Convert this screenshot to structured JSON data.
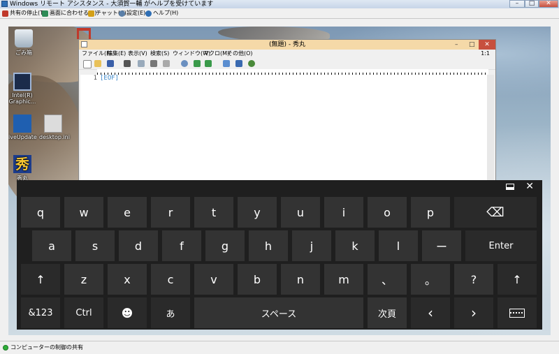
{
  "window": {
    "title": "Windows リモート アシスタンス - 大須賀一輔 がヘルプを受けています"
  },
  "toolbar": {
    "items": [
      {
        "label": "共有の停止(T)",
        "icon": "stop-share-icon",
        "color": "#c0392b"
      },
      {
        "label": "画面に合わせる(S)",
        "icon": "fit-screen-icon",
        "color": "#2e8b57"
      },
      {
        "label": "チャット(C)",
        "icon": "chat-icon",
        "color": "#d4a017"
      },
      {
        "label": "設定(E)",
        "icon": "settings-icon",
        "color": "#5a7fa8"
      },
      {
        "label": "ヘルプ(H)",
        "icon": "help-icon",
        "color": "#2f6fb5"
      }
    ]
  },
  "status": {
    "text": "コンピューターの制御の共有"
  },
  "desktop": {
    "icons": [
      {
        "label": "ごみ箱"
      },
      {
        "label": "Intel(R) Graphic..."
      },
      {
        "label": "iveUpdate"
      },
      {
        "label": "desktop.ini"
      },
      {
        "label": "秀丸"
      }
    ]
  },
  "editor": {
    "title": "(無題) - 秀丸",
    "menu": [
      "ファイル(F)",
      "編集(E)",
      "表示(V)",
      "検索(S)",
      "ウィンドウ(W)",
      "マクロ(M)",
      "その他(O)"
    ],
    "cursor_pos": "1:1",
    "line_number": "1",
    "eof": "[EOF]"
  },
  "keyboard": {
    "rows": [
      [
        "q",
        "w",
        "e",
        "r",
        "t",
        "y",
        "u",
        "i",
        "o",
        "p"
      ],
      [
        "a",
        "s",
        "d",
        "f",
        "g",
        "h",
        "j",
        "k",
        "l",
        "ー"
      ],
      [
        "z",
        "x",
        "c",
        "v",
        "b",
        "n",
        "m",
        "、",
        "。",
        "?"
      ]
    ],
    "enter": "Enter",
    "shift": "↑",
    "backspace": "⌫",
    "numsym": "&123",
    "ctrl": "Ctrl",
    "emoji": "☻",
    "kana": "あ",
    "space": "スペース",
    "next": "次頁",
    "left": "‹",
    "right": "›",
    "close": "✕"
  },
  "colors": {
    "keyboard_bg": "#1f1f1f",
    "key_bg": "#333333",
    "editor_title": "#f5d9a8",
    "eof": "#3a86c8"
  }
}
